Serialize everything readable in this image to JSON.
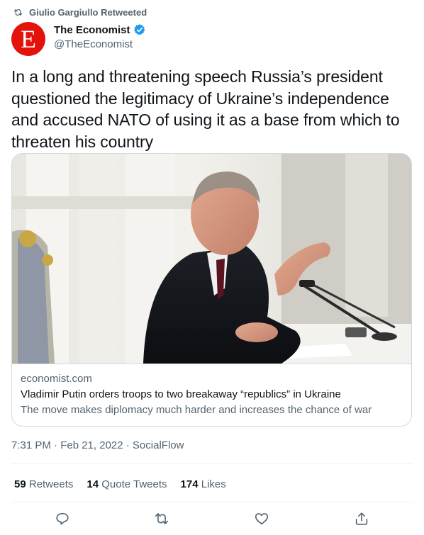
{
  "retweet": {
    "label": "Giulio Gargiullo Retweeted"
  },
  "author": {
    "avatar_letter": "E",
    "name": "The Economist",
    "handle": "@TheEconomist",
    "avatar_color": "#e3120b"
  },
  "tweet": {
    "text": "In a long and threatening speech Russia’s president questioned the legitimacy of Ukraine’s independence and accused NATO of using it as a base from which to threaten his country"
  },
  "card": {
    "domain": "economist.com",
    "title": "Vladimir Putin orders troops to two breakaway “republics” in Ukraine",
    "description": "The move makes diplomacy much harder and increases the chance of war"
  },
  "meta": {
    "text": "7:31 PM · Feb 21, 2022 · SocialFlow"
  },
  "stats": {
    "retweets_count": "59",
    "retweets_label": "Retweets",
    "quotes_count": "14",
    "quotes_label": "Quote Tweets",
    "likes_count": "174",
    "likes_label": "Likes"
  },
  "icons": {
    "retweet_header": "retweet-icon",
    "verified": "verified-badge-icon",
    "reply": "reply-icon",
    "retweet": "retweet-icon",
    "like": "heart-icon",
    "share": "share-icon"
  },
  "colors": {
    "accent": "#1d9bf0",
    "muted": "#536471",
    "text": "#0f1419"
  }
}
